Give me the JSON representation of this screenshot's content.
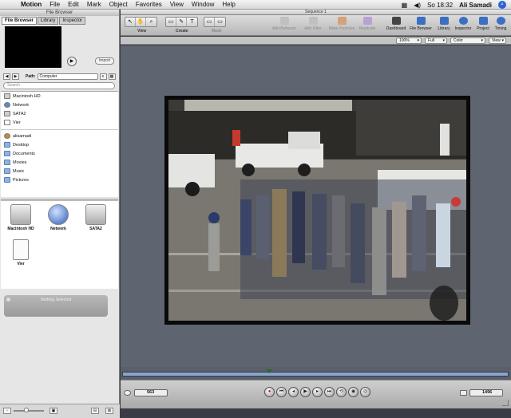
{
  "menubar": {
    "items": [
      "Motion",
      "File",
      "Edit",
      "Mark",
      "Object",
      "Favorites",
      "View",
      "Window",
      "Help"
    ],
    "clock": "So 18:32",
    "user": "Ali Samadi"
  },
  "file_browser": {
    "title": "File Browser",
    "tabs": [
      "File Browser",
      "Library",
      "Inspector"
    ],
    "import_label": "Import",
    "path_label": "Path:",
    "path_value": "Computer",
    "search_placeholder": "Search",
    "list": [
      "Macintosh HD",
      "Network",
      "SATA2",
      "Vier",
      "alisamadi",
      "Desktop",
      "Documents",
      "Movies",
      "Music",
      "Pictures"
    ],
    "grid": [
      "Macintosh HD",
      "Network",
      "SATA2",
      "Vier"
    ],
    "nothing_selected": "Nothing Selected"
  },
  "canvas": {
    "sequence_title": "Sequence 1",
    "tool_groups": [
      "View",
      "Create",
      "Mask"
    ],
    "toolbar_left": [
      "Add Behavior",
      "Add Filter",
      "Make Particles",
      "Replicate"
    ],
    "toolbar_right": [
      "Dashboard",
      "File Browser",
      "Library",
      "Inspector",
      "Project",
      "Timing"
    ],
    "options": {
      "zoom": "100%",
      "resolution": "Full",
      "channel": "Color",
      "view": "View"
    }
  },
  "transport": {
    "current_frame": "563",
    "end_frame": "1496"
  },
  "colors": {
    "canvas_bg": "#5f6570",
    "timeline_bar": "#8ea3c8",
    "accent_blue": "#3a6fc4"
  }
}
